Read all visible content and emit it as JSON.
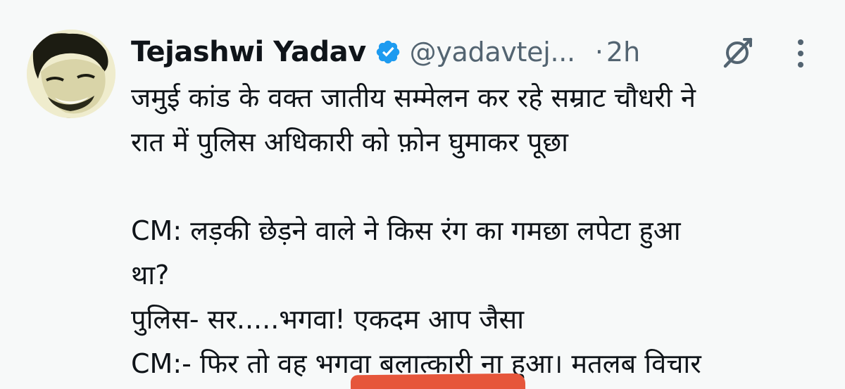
{
  "tweet": {
    "display_name": "Tejashwi Yadav",
    "handle": "@yadavtej...",
    "separator": "·",
    "time": "2h",
    "lines": [
      "जमुई कांड के वक्त जातीय सम्मेलन कर रहे सम्राट चौधरी ने",
      "रात में पुलिस अधिकारी को फ़ोन घुमाकर पूछा",
      "",
      "CM: लड़की छेड़ने वाले ने किस रंग का गमछा लपेटा हुआ",
      "था?",
      "पुलिस- सर.....भगवा! एकदम आप जैसा",
      "CM:- फिर तो वह भगवा बलात्कारी ना हुआ। मतलब विचार"
    ]
  },
  "icons": {
    "verified": "verified-badge-icon",
    "grok": "grok-icon",
    "more": "more-vertical-icon"
  },
  "colors": {
    "verified_blue": "#1d9bf0",
    "secondary_text": "#536471",
    "highlight_red": "#e6563b",
    "background": "#f7f9f9"
  }
}
